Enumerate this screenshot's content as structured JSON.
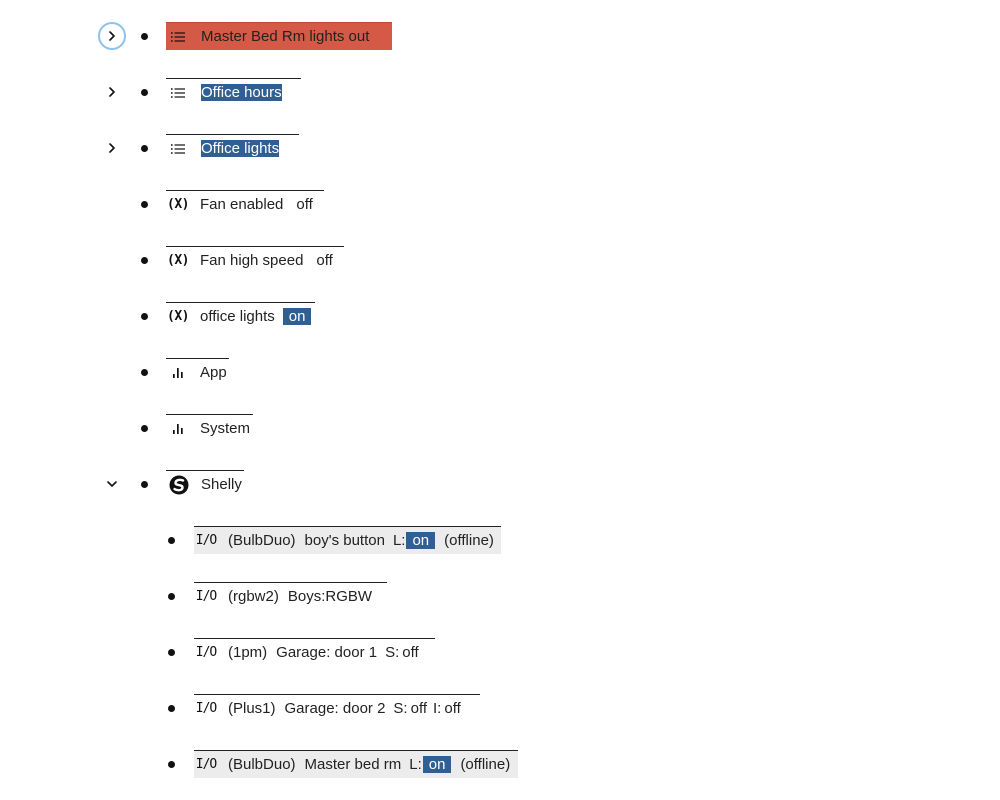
{
  "items": [
    {
      "kind": "group",
      "label": "Master Bed Rm lights out",
      "icon": "list-icon",
      "alert": true,
      "expand": "collapsed",
      "focused": true,
      "selected": false
    },
    {
      "kind": "group",
      "label": "Office hours",
      "icon": "list-icon",
      "alert": false,
      "expand": "collapsed",
      "focused": false,
      "selected": true
    },
    {
      "kind": "group",
      "label": "Office lights",
      "icon": "list-icon",
      "alert": false,
      "expand": "collapsed",
      "focused": false,
      "selected": true
    },
    {
      "kind": "variable",
      "label": "Fan enabled",
      "icon": "variable-icon",
      "icon_text": "(X)",
      "value": "off",
      "value_highlight": false
    },
    {
      "kind": "variable",
      "label": "Fan high speed",
      "icon": "variable-icon",
      "icon_text": "(X)",
      "value": "off",
      "value_highlight": false
    },
    {
      "kind": "variable",
      "label": "office lights",
      "icon": "variable-icon",
      "icon_text": "(X)",
      "value": "on",
      "value_highlight": true
    },
    {
      "kind": "metric",
      "label": "App",
      "icon": "bar-chart-icon"
    },
    {
      "kind": "metric",
      "label": "System",
      "icon": "bar-chart-icon"
    },
    {
      "kind": "integration",
      "label": "Shelly",
      "icon": "shelly-logo-icon",
      "expand": "expanded"
    },
    {
      "kind": "device",
      "icon": "io-icon",
      "icon_text": "I/O",
      "model": "(BulbDuo)",
      "name": "boy's button",
      "states": [
        {
          "key": "L:",
          "value": "on",
          "highlight": true
        }
      ],
      "status": "(offline)",
      "grey": true
    },
    {
      "kind": "device",
      "icon": "io-icon",
      "icon_text": "I/O",
      "model": "(rgbw2)",
      "name": "Boys:RGBW",
      "states": [],
      "status": "",
      "grey": false
    },
    {
      "kind": "device",
      "icon": "io-icon",
      "icon_text": "I/O",
      "model": "(1pm)",
      "name": "Garage: door 1",
      "states": [
        {
          "key": "S:",
          "value": "off",
          "highlight": false
        }
      ],
      "status": "",
      "grey": false
    },
    {
      "kind": "device",
      "icon": "io-icon",
      "icon_text": "I/O",
      "model": "(Plus1)",
      "name": "Garage: door 2",
      "states": [
        {
          "key": "S:",
          "value": "off",
          "highlight": false
        },
        {
          "key": "I:",
          "value": "off",
          "highlight": false
        }
      ],
      "status": "",
      "grey": false
    },
    {
      "kind": "device",
      "icon": "io-icon",
      "icon_text": "I/O",
      "model": "(BulbDuo)",
      "name": "Master bed rm",
      "states": [
        {
          "key": "L:",
          "value": "on",
          "highlight": true
        }
      ],
      "status": "(offline)",
      "grey": true
    }
  ],
  "colors": {
    "alert": "#d45a47",
    "selection": "#2f5f93",
    "focus_ring": "#8cc2ec",
    "offline_row": "#ececec"
  }
}
